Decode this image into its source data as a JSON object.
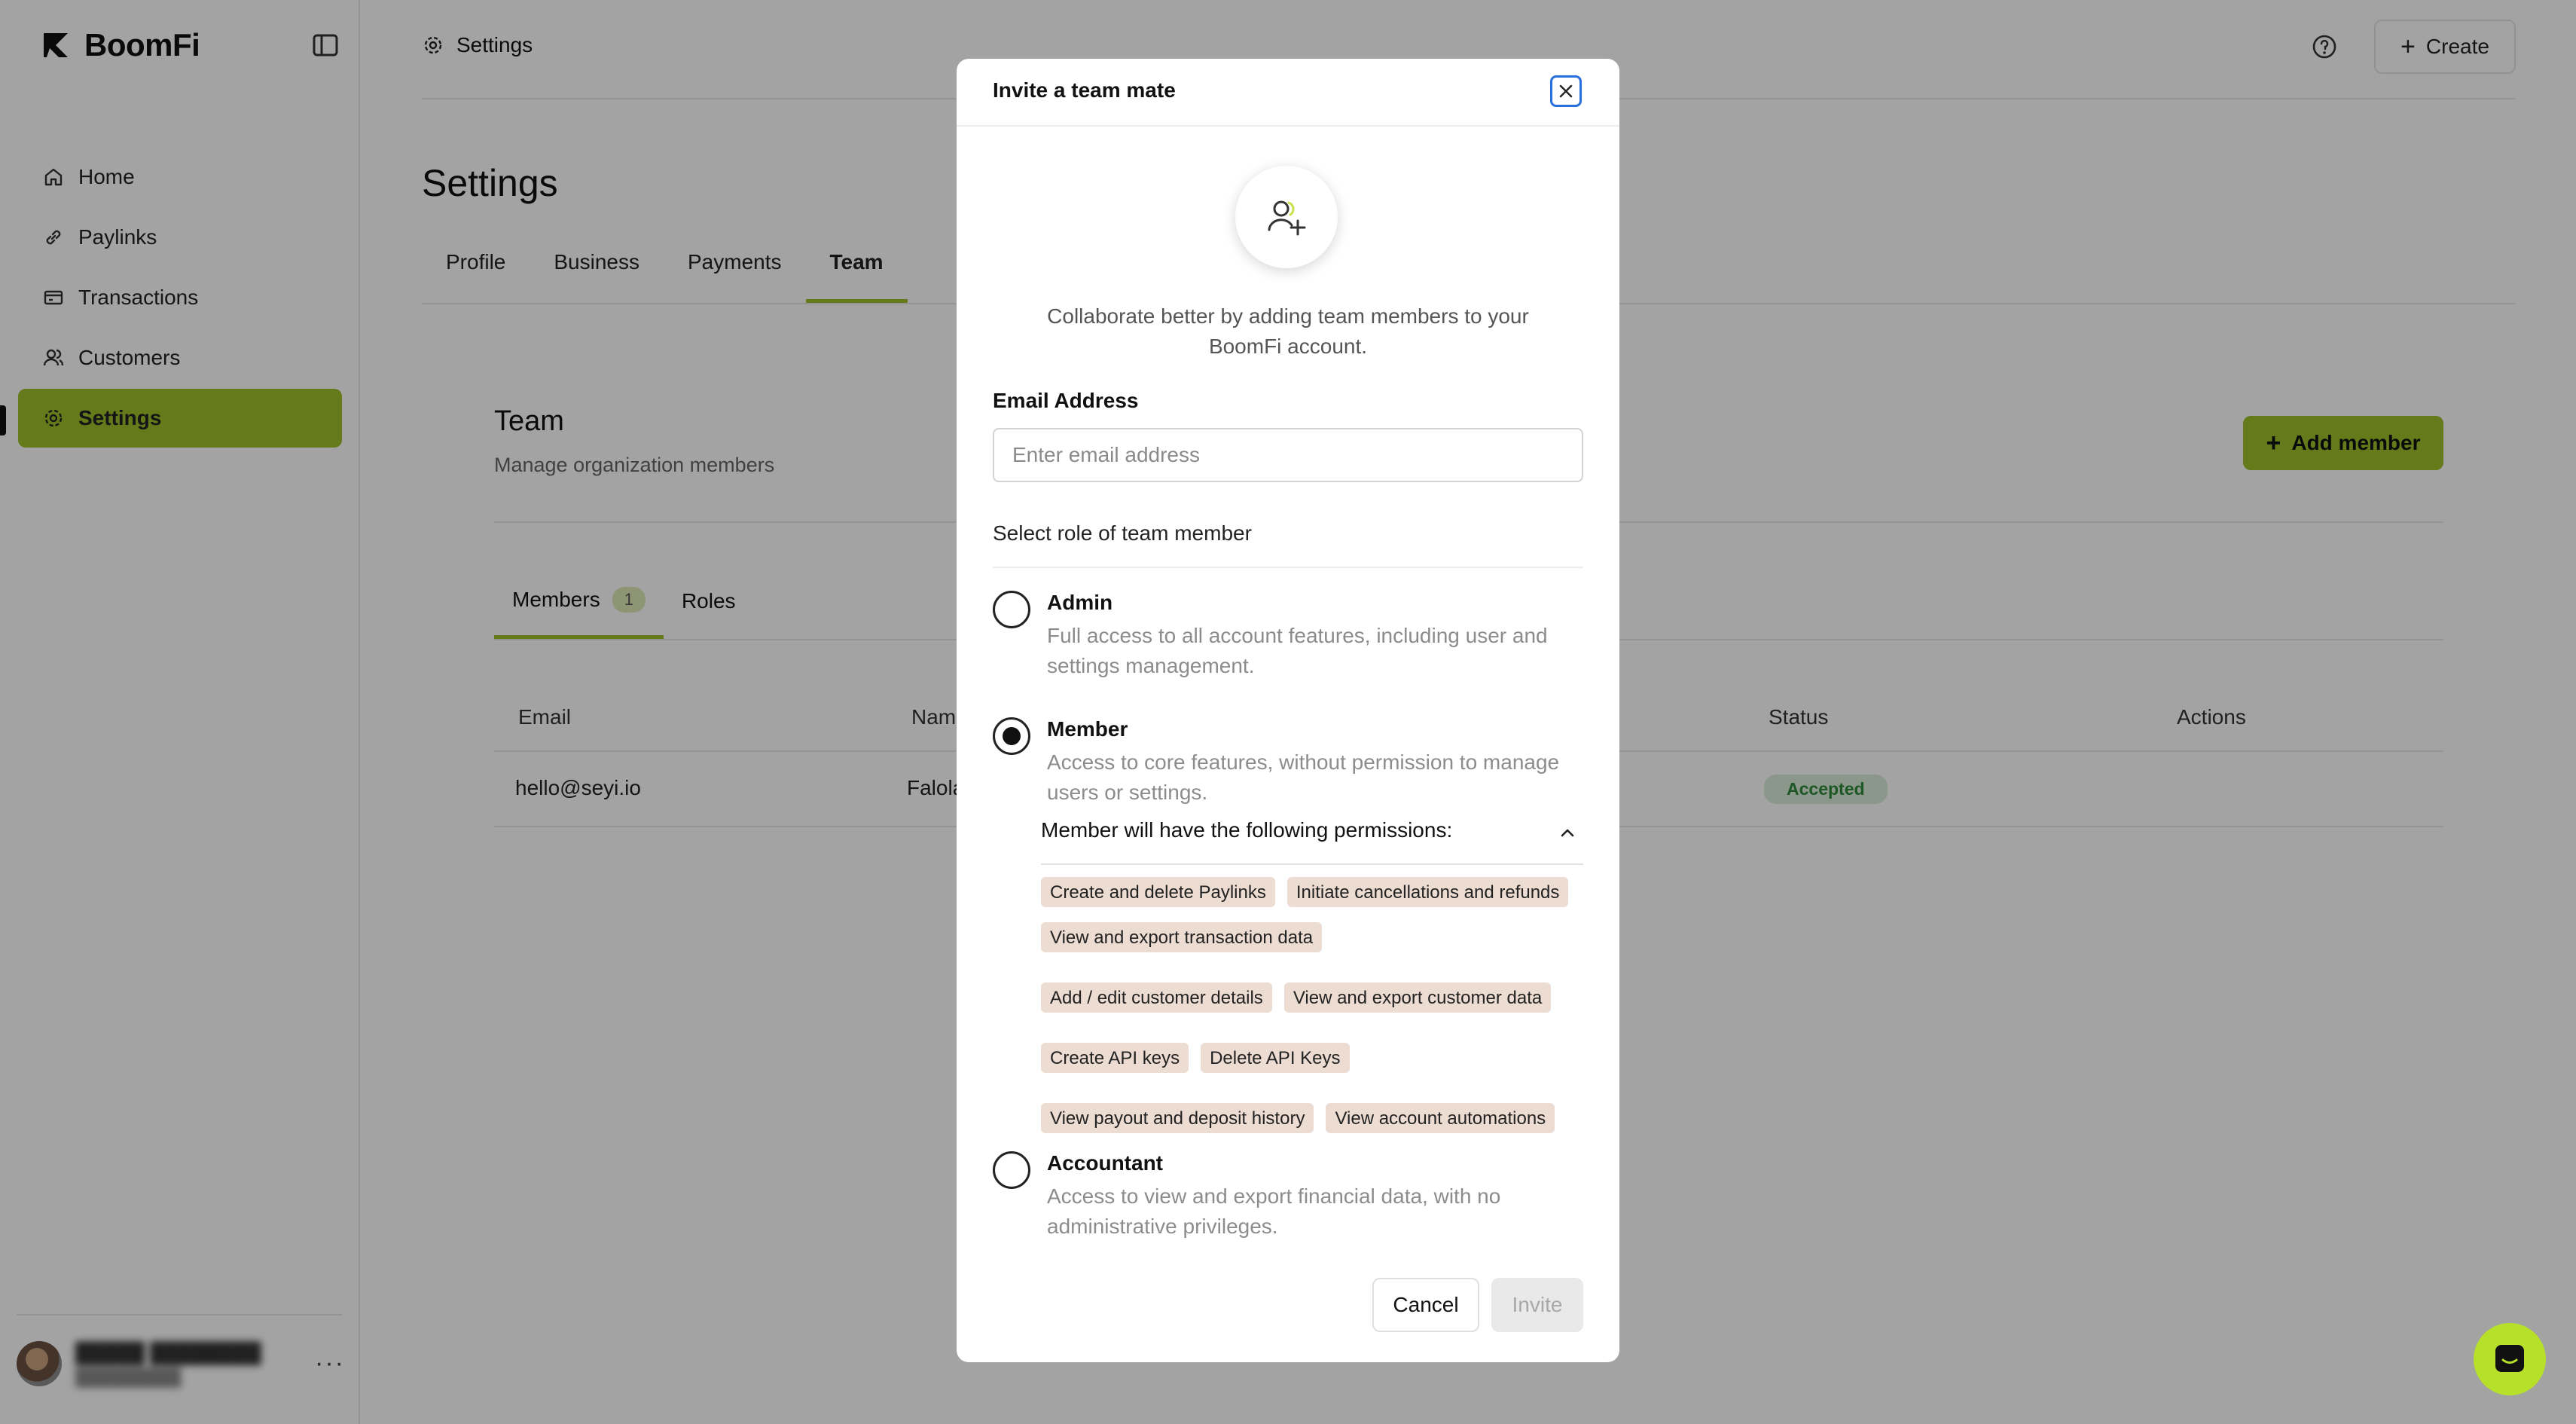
{
  "app": {
    "brand": "BoomFi"
  },
  "sidebar": {
    "items": [
      {
        "label": "Home",
        "icon": "home-icon"
      },
      {
        "label": "Paylinks",
        "icon": "link-icon"
      },
      {
        "label": "Transactions",
        "icon": "transactions-icon"
      },
      {
        "label": "Customers",
        "icon": "users-icon"
      },
      {
        "label": "Settings",
        "icon": "gear-icon",
        "active": true
      }
    ]
  },
  "header": {
    "breadcrumb": "Settings",
    "create_label": "Create"
  },
  "page": {
    "title": "Settings",
    "tabs": [
      "Profile",
      "Business",
      "Payments",
      "Team"
    ],
    "active_tab": "Team"
  },
  "team": {
    "title": "Team",
    "subtitle": "Manage organization members",
    "add_member_label": "Add member",
    "subtabs": {
      "members": "Members",
      "members_count": "1",
      "roles": "Roles"
    },
    "columns": [
      "Email",
      "Name",
      "Status",
      "Actions"
    ],
    "rows": [
      {
        "email": "hello@seyi.io",
        "name": "Falola",
        "status": "Accepted"
      }
    ]
  },
  "modal": {
    "title": "Invite a team mate",
    "intro": "Collaborate better by adding team members to your BoomFi account.",
    "email_label": "Email Address",
    "email_placeholder": "Enter email address",
    "email_value": "",
    "role_label": "Select role of team member",
    "roles": [
      {
        "name": "Admin",
        "desc": "Full access to all account features, including user and settings management.",
        "selected": false
      },
      {
        "name": "Member",
        "desc": "Access to core features, without permission to manage users or settings.",
        "selected": true
      },
      {
        "name": "Accountant",
        "desc": "Access to view and export financial data, with no administrative privileges.",
        "selected": false
      }
    ],
    "permissions_header": "Member will have the following permissions:",
    "permissions": [
      "Create and delete Paylinks",
      "Initiate cancellations and refunds",
      "View and export transaction data",
      "Add / edit customer details",
      "View and export customer data",
      "Create API keys",
      "Delete API Keys",
      "View payout and deposit history",
      "View account automations"
    ],
    "cancel_label": "Cancel",
    "invite_label": "Invite"
  },
  "colors": {
    "accent": "#9fc12b",
    "chat": "#b6e02a",
    "chip": "#ecdcd2",
    "focus": "#2a6fdb"
  }
}
